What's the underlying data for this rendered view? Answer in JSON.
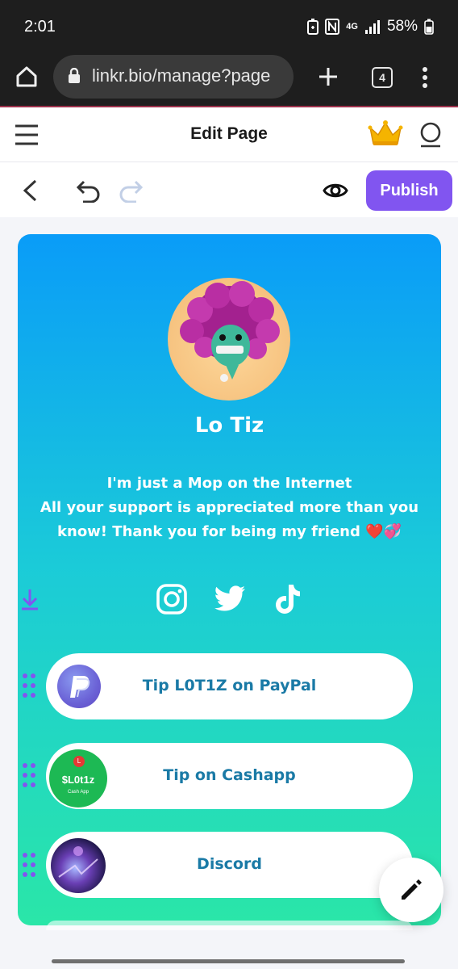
{
  "status_bar": {
    "time": "2:01",
    "network": "4G",
    "battery": "58%"
  },
  "browser": {
    "url": "linkr.bio/manage?page",
    "tab_count": "4"
  },
  "header": {
    "title": "Edit Page",
    "crown_badge": "PRO"
  },
  "toolbar": {
    "publish_label": "Publish"
  },
  "profile": {
    "name": "Lo Tiz",
    "bio_line1": "I'm just a Mop on the Internet",
    "bio_line2": "All your support is appreciated more than you",
    "bio_line3": "know! Thank you for being my friend ❤️💞",
    "socials": [
      "instagram-icon",
      "twitter-icon",
      "tiktok-icon"
    ]
  },
  "links": [
    {
      "label": "Tip L0T1Z on PayPal",
      "thumb": "paypal"
    },
    {
      "label": "Tip on Cashapp",
      "thumb": "cashapp",
      "thumb_text": "$L0t1z",
      "thumb_badge": "L",
      "thumb_caption": "Cash App"
    },
    {
      "label": "Discord",
      "thumb": "discord"
    }
  ],
  "colors": {
    "accent": "#8155f0",
    "link_text": "#1a7aa6",
    "gradient_top": "#0a9cf8",
    "gradient_bottom": "#2ae6a8"
  }
}
